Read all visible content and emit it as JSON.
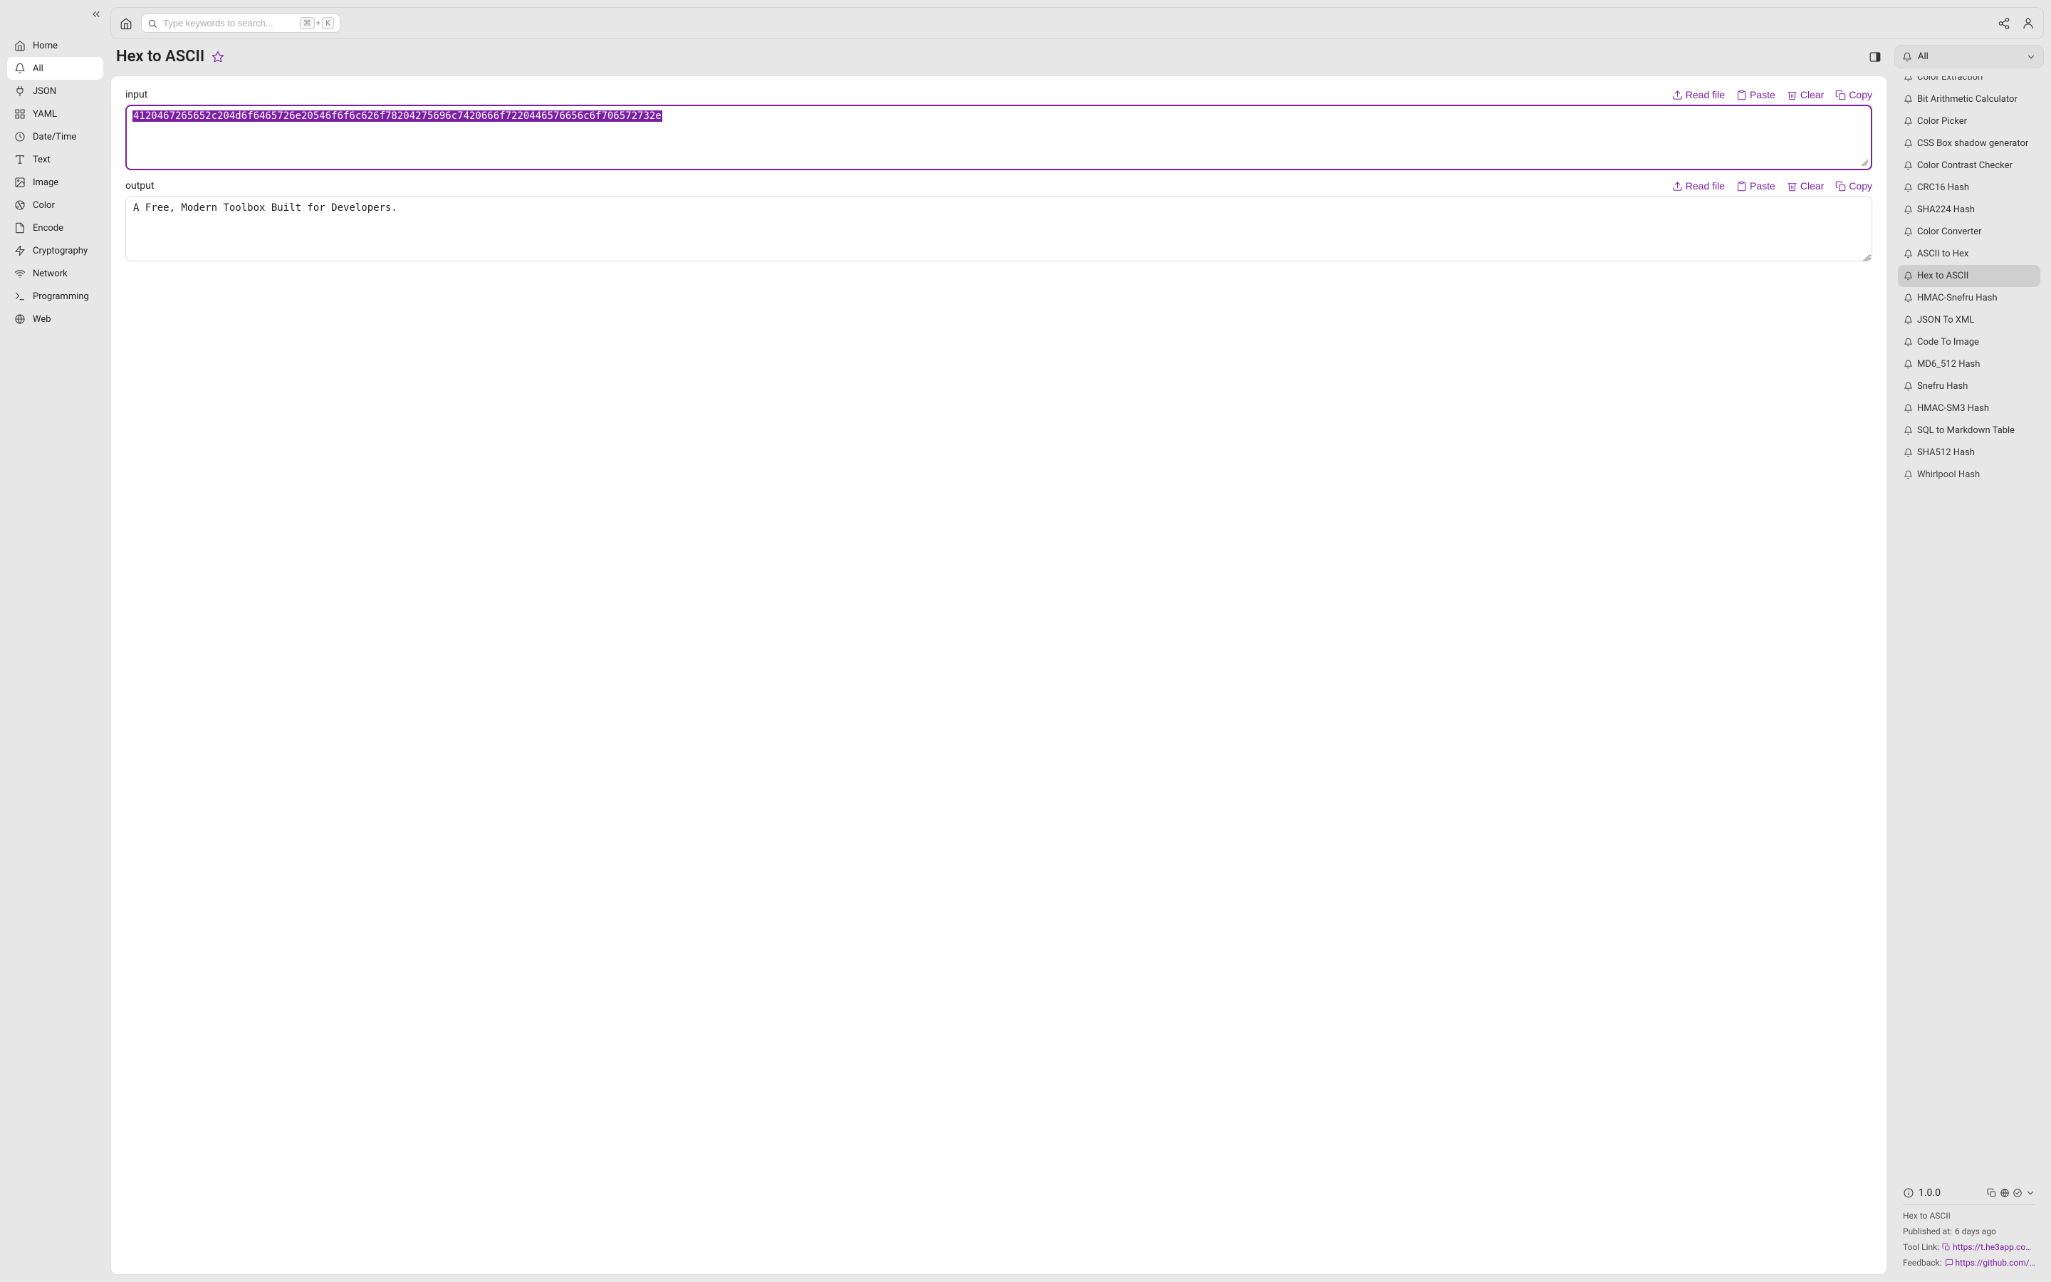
{
  "sidebar": {
    "items": [
      {
        "label": "Home"
      },
      {
        "label": "All"
      },
      {
        "label": "JSON"
      },
      {
        "label": "YAML"
      },
      {
        "label": "Date/Time"
      },
      {
        "label": "Text"
      },
      {
        "label": "Image"
      },
      {
        "label": "Color"
      },
      {
        "label": "Encode"
      },
      {
        "label": "Cryptography"
      },
      {
        "label": "Network"
      },
      {
        "label": "Programming"
      },
      {
        "label": "Web"
      }
    ],
    "active_index": 1
  },
  "topbar": {
    "search_placeholder": "Type keywords to search...",
    "kbd_mod": "⌘",
    "kbd_plus": "+",
    "kbd_key": "K"
  },
  "title": "Hex to ASCII",
  "io": {
    "input_label": "input",
    "output_label": "output",
    "input_value": "4120467265652c204d6f6465726e20546f6f6c626f78204275696c7420666f7220446576656c6f706572732e",
    "output_value": "A Free, Modern Toolbox Built for Developers.",
    "actions": {
      "read_file": "Read file",
      "paste": "Paste",
      "clear": "Clear",
      "copy": "Copy"
    }
  },
  "right": {
    "filter_label": "All",
    "tools": [
      {
        "label": "Color Extraction",
        "cutoff": "top"
      },
      {
        "label": "Bit Arithmetic Calculator"
      },
      {
        "label": "Color Picker"
      },
      {
        "label": "CSS Box shadow generator"
      },
      {
        "label": "Color Contrast Checker"
      },
      {
        "label": "CRC16 Hash"
      },
      {
        "label": "SHA224 Hash"
      },
      {
        "label": "Color Converter"
      },
      {
        "label": "ASCII to Hex"
      },
      {
        "label": "Hex to ASCII",
        "active": true
      },
      {
        "label": "HMAC-Snefru Hash"
      },
      {
        "label": "JSON To XML"
      },
      {
        "label": "Code To Image"
      },
      {
        "label": "MD6_512 Hash"
      },
      {
        "label": "Snefru Hash"
      },
      {
        "label": "HMAC-SM3 Hash"
      },
      {
        "label": "SQL to Markdown Table"
      },
      {
        "label": "SHA512 Hash"
      },
      {
        "label": "Whirlpool Hash",
        "cutoff": "bottom"
      }
    ]
  },
  "info": {
    "version": "1.0.0",
    "tool_name": "Hex to ASCII",
    "published_label": "Published at:",
    "published_value": "6 days ago",
    "tool_link_label": "Tool Link:",
    "tool_link_value": "https://t.he3app.co…",
    "feedback_label": "Feedback:",
    "feedback_value": "https://github.com/…"
  }
}
